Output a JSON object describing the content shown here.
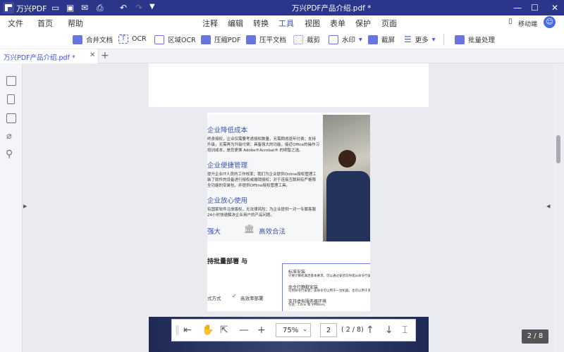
{
  "app": {
    "name": "万兴PDF",
    "doc_title": "万兴PDF产品介绍.pdf *"
  },
  "menu": {
    "left": [
      "文件",
      "首页",
      "帮助"
    ],
    "tabs": [
      "注释",
      "编辑",
      "转换",
      "工具",
      "视图",
      "表单",
      "保护",
      "页面"
    ],
    "active_tab": "工具",
    "mobile": "移动端"
  },
  "toolbar": [
    "合并文档",
    "OCR",
    "区域OCR",
    "压缩PDF",
    "压平文档",
    "裁剪",
    "水印",
    "截屏",
    "更多",
    "批量处理"
  ],
  "tab": {
    "label": "万兴PDF产品介绍.pdf *"
  },
  "doc": {
    "h1": "企业降低成本",
    "p1": [
      "终身授权，企业仅需要考虑授权数量，无需顾虑逐年付费；支持",
      "升级，无需再为升级付费；具备强大的功能，接近Office的操作习",
      "培训成本，是您更换 Adobe®Acrobat® 的明智之选。"
    ],
    "h2": "企业便捷管理",
    "p2": [
      "提升企业IT人员的工作效率；我们为企业提供Online授权管理工",
      "装了软件的设备进行授权或撤销授权；对于连接互联网有严格限",
      "全功能的安装包，并提供Offline授权管理工具。"
    ],
    "h3": "企业放心使用",
    "p3": [
      "有国家软件注册版权，无法律风险；为企业提供一对一专属客服",
      "24小时快速解决企业用户的产品问题。"
    ],
    "f1": "强大",
    "f2": "高效合法",
    "h4": "持批量部署 与",
    "m1": "式方式",
    "m2": "高效率部署",
    "box": [
      {
        "t": "标准安装",
        "d": "只要计算机满足基本要求，可以通过安装向导或从命令行安"
      },
      {
        "t": "命令行静默安装",
        "d": "可用命令行安装；该命令可以用于一台机器，也可以用于多"
      },
      {
        "t": "支持虚拟服务器环境",
        "d": "包括：Citrix 和 VMWare。"
      }
    ]
  },
  "bottom": {
    "zoom": "75%",
    "page": "2",
    "total": "( 2 / 8)"
  },
  "page_indicator": "2 / 8"
}
